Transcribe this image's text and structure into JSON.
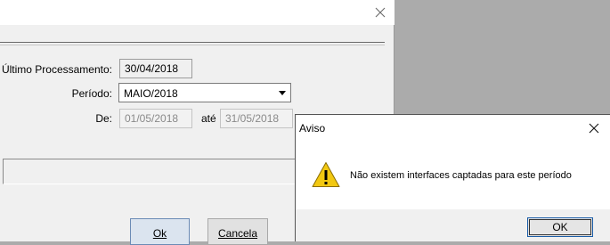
{
  "main": {
    "labels": {
      "ultimo": "Último Processamento:",
      "periodo": "Período:",
      "de": "De:",
      "ate": "até"
    },
    "fields": {
      "ultimo_value": "30/04/2018",
      "periodo_value": "MAIO/2018",
      "de_value": "01/05/2018",
      "ate_value": "31/05/2018"
    },
    "buttons": {
      "ok_label": "Ok",
      "cancela_label": "Cancela"
    }
  },
  "aviso": {
    "title": "Aviso",
    "message": "Não existem interfaces captadas para este período",
    "ok_label": "OK"
  },
  "icons": {
    "close": "close-icon",
    "dropdown": "chevron-down-icon",
    "warning": "warning-icon"
  },
  "colors": {
    "warning_fill": "#f2c811",
    "button_default_border": "#1b5ea8"
  }
}
